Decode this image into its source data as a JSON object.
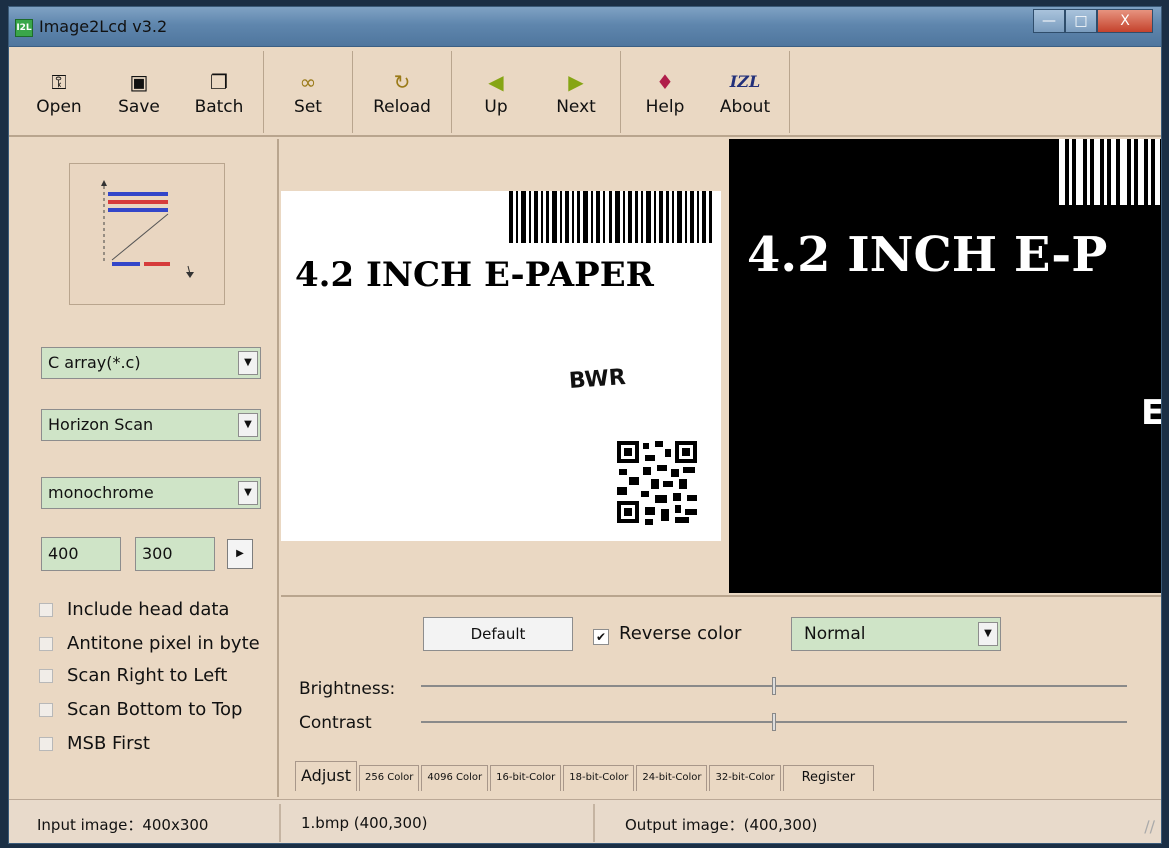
{
  "window": {
    "title": "Image2Lcd v3.2",
    "app_icon_text": "I2L"
  },
  "window_controls": {
    "minimize": "—",
    "maximize": "□",
    "close": "X"
  },
  "toolbar": {
    "group1": [
      {
        "label": "Open",
        "icon": "open-icon"
      },
      {
        "label": "Save",
        "icon": "save-icon"
      },
      {
        "label": "Batch",
        "icon": "batch-icon"
      }
    ],
    "group2": [
      {
        "label": "Set",
        "icon": "glasses-icon"
      }
    ],
    "group3": [
      {
        "label": "Reload",
        "icon": "reload-icon"
      }
    ],
    "group4": [
      {
        "label": "Up",
        "icon": "arrow-left-icon"
      },
      {
        "label": "Next",
        "icon": "arrow-right-icon"
      }
    ],
    "group5": [
      {
        "label": "Help",
        "icon": "help-icon"
      },
      {
        "label": "About",
        "icon": "izl-logo-icon",
        "glyph": "IZL"
      }
    ]
  },
  "left": {
    "output_type": "C array(*.c)",
    "scan_mode": "Horizon Scan",
    "color_mode": "monochrome",
    "width": "400",
    "height": "300",
    "checks": [
      {
        "label": "Include head data",
        "checked": false
      },
      {
        "label": "Antitone pixel in byte",
        "checked": false
      },
      {
        "label": "Scan Right to Left",
        "checked": false
      },
      {
        "label": "Scan Bottom to Top",
        "checked": false
      },
      {
        "label": "MSB First",
        "checked": false
      }
    ]
  },
  "preview": {
    "input_heading": "4.2 INCH E-PAPER",
    "input_sub": "BWR",
    "output_heading": "4.2 INCH E-P",
    "output_sub": "E"
  },
  "adjust": {
    "default_label": "Default",
    "reverse_color_label": "Reverse color",
    "reverse_checked": true,
    "mode_value": "Normal",
    "brightness_label": "Brightness:",
    "contrast_label": "Contrast",
    "brightness_level": 0.5,
    "contrast_level": 0.5
  },
  "tabs": [
    "Adjust",
    "256 Color",
    "4096 Color",
    "16-bit-Color",
    "18-bit-Color",
    "24-bit-Color",
    "32-bit-Color",
    "Register"
  ],
  "status": {
    "input": "Input image：400x300",
    "file": "1.bmp (400,300)",
    "output": "Output image：(400,300)"
  },
  "colors": {
    "panel": "#ead8c3",
    "field": "#cfe4c7",
    "title": "#6a8fb5"
  }
}
